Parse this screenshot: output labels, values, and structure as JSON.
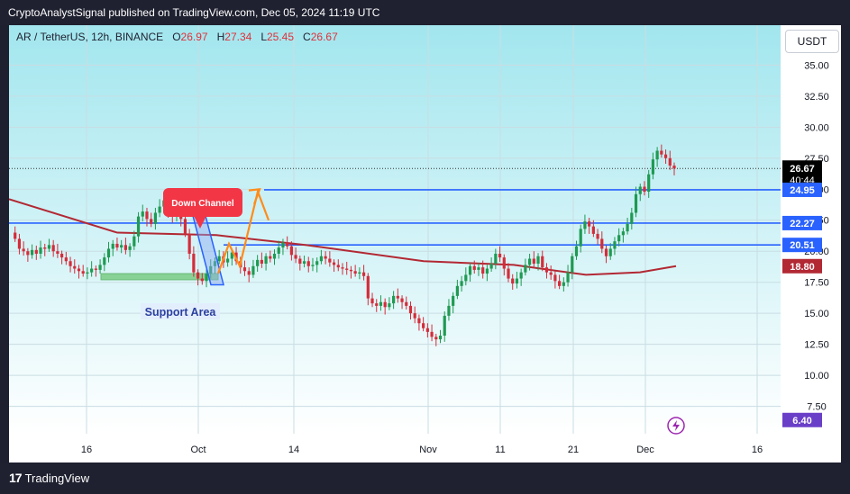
{
  "header": {
    "publisher_line": "CryptoAnalystSignal published on TradingView.com, Dec 05, 2024 11:19 UTC"
  },
  "legend": {
    "symbol": "AR / TetherUS, 12h, BINANCE",
    "open_label": "O",
    "open": "26.97",
    "high_label": "H",
    "high": "27.34",
    "low_label": "L",
    "low": "25.45",
    "close_label": "C",
    "close": "26.67"
  },
  "currency_button": "USDT",
  "footer": {
    "brand": "TradingView"
  },
  "annotations": {
    "down_channel": "Down Channel",
    "support_area": "Support Area"
  },
  "price_badges": [
    {
      "label": "26.67",
      "sub": "40:44",
      "value": 26.67,
      "bg": "#000000"
    },
    {
      "label": "24.95",
      "value": 24.95,
      "bg": "#2962ff"
    },
    {
      "label": "22.27",
      "value": 22.27,
      "bg": "#2962ff"
    },
    {
      "label": "20.51",
      "value": 20.51,
      "bg": "#2962ff"
    },
    {
      "label": "18.80",
      "value": 18.8,
      "bg": "#b22833"
    },
    {
      "label": "6.40",
      "value": 6.4,
      "bg": "#6a3fc8"
    }
  ],
  "colors": {
    "bg_top": "#a2e6ee",
    "bg_bottom": "#ffffff",
    "up": "#1f9a52",
    "down": "#d42c3a",
    "hline": "#2962ff",
    "ma": "#b22833",
    "arrow": "#ff8c1a",
    "channel": "#2962ff",
    "support": "#7ecf8a"
  },
  "chart_data": {
    "type": "candlestick",
    "title": "AR / TetherUS, 12h, BINANCE",
    "timeframe": "12h",
    "y_ticks": [
      "35.00",
      "32.50",
      "30.00",
      "27.50",
      "25.00",
      "22.50",
      "20.00",
      "17.50",
      "15.00",
      "12.50",
      "10.00",
      "7.50"
    ],
    "x_ticks": [
      "16",
      "Oct",
      "14",
      "Nov",
      "11",
      "21",
      "Dec",
      "16"
    ],
    "ylim": [
      5.0,
      39.0
    ],
    "horizontal_levels": [
      24.95,
      22.27,
      20.51
    ],
    "moving_average_last": 18.8,
    "series": [
      {
        "name": "price",
        "values": [
          21.5,
          21.0,
          20.2,
          20.0,
          19.7,
          20.1,
          19.8,
          20.3,
          20.2,
          20.5,
          20.0,
          19.8,
          19.5,
          19.2,
          18.8,
          18.6,
          18.4,
          18.2,
          18.3,
          18.6,
          18.5,
          18.9,
          19.5,
          20.2,
          20.6,
          20.3,
          20.5,
          20.1,
          20.4,
          21.2,
          22.8,
          23.2,
          22.6,
          22.2,
          23.1,
          23.6,
          24.1,
          23.0,
          22.8,
          23.2,
          22.6,
          21.4,
          19.8,
          18.3,
          17.8,
          17.6,
          18.2,
          18.8,
          19.2,
          19.6,
          19.1,
          19.4,
          19.9,
          19.2,
          18.7,
          18.4,
          18.1,
          18.8,
          19.3,
          19.0,
          19.6,
          19.4,
          19.8,
          20.3,
          20.7,
          20.4,
          19.7,
          19.4,
          19.0,
          19.2,
          18.8,
          18.9,
          19.2,
          19.6,
          19.4,
          19.1,
          18.9,
          18.7,
          18.6,
          18.5,
          18.4,
          18.2,
          18.3,
          18.0,
          16.2,
          15.8,
          15.6,
          15.9,
          15.5,
          15.8,
          16.4,
          16.2,
          15.9,
          15.6,
          15.0,
          14.6,
          14.2,
          13.8,
          13.5,
          13.1,
          12.9,
          13.2,
          14.8,
          15.6,
          16.4,
          17.2,
          17.6,
          18.1,
          18.8,
          18.5,
          18.7,
          18.2,
          18.6,
          19.0,
          19.8,
          19.5,
          18.6,
          17.8,
          17.4,
          17.8,
          18.3,
          18.9,
          19.4,
          19.0,
          19.6,
          18.7,
          18.3,
          18.1,
          17.6,
          17.2,
          17.5,
          18.3,
          19.6,
          20.4,
          21.8,
          22.4,
          22.0,
          21.4,
          21.0,
          20.2,
          19.6,
          20.2,
          20.8,
          21.3,
          21.6,
          22.2,
          23.1,
          24.6,
          25.2,
          24.8,
          26.2,
          27.4,
          28.1,
          27.8,
          27.5,
          26.9,
          26.67
        ]
      },
      {
        "name": "MA",
        "values": [
          24.2,
          21.3,
          20.5,
          19.6,
          18.9,
          18.8
        ]
      }
    ]
  }
}
